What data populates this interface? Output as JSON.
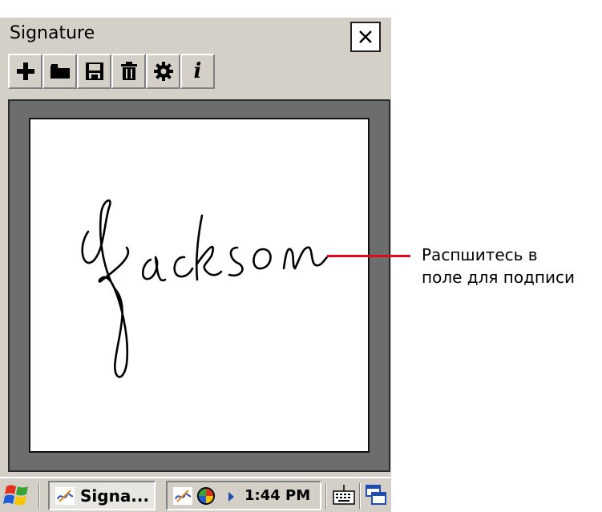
{
  "window": {
    "title": "Signature",
    "close_icon": "close-icon"
  },
  "toolbar": {
    "buttons": [
      {
        "name": "new-button",
        "icon": "plus-icon"
      },
      {
        "name": "open-button",
        "icon": "folder-icon"
      },
      {
        "name": "save-button",
        "icon": "floppy-disk-icon"
      },
      {
        "name": "delete-button",
        "icon": "trash-icon"
      },
      {
        "name": "settings-button",
        "icon": "gear-icon"
      },
      {
        "name": "info-button",
        "icon": "info-icon",
        "glyph": "i"
      }
    ]
  },
  "canvas": {
    "signature": "Jackson"
  },
  "taskbar": {
    "start_icon": "windows-flag-icon",
    "task_label": "Signa...",
    "clock": "1:44 PM",
    "tray_icons": [
      "signature-app-icon",
      "color-wheel-icon",
      "expand-arrow-icon"
    ],
    "keyboard_icon": "keyboard-icon",
    "switch_icon": "window-switch-icon"
  },
  "callout": {
    "line1": "Распшитесь в",
    "line2": "поле для подписи",
    "color": "#e3061b"
  }
}
